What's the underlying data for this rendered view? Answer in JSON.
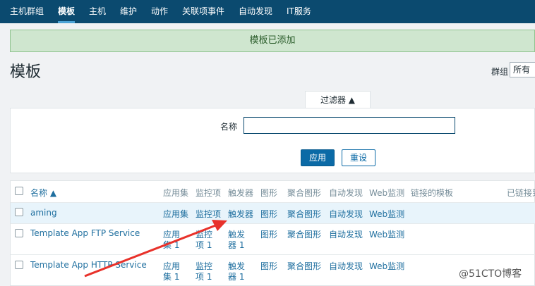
{
  "nav": {
    "items": [
      {
        "label": "主机群组",
        "active": false
      },
      {
        "label": "模板",
        "active": true
      },
      {
        "label": "主机",
        "active": false
      },
      {
        "label": "维护",
        "active": false
      },
      {
        "label": "动作",
        "active": false
      },
      {
        "label": "关联项事件",
        "active": false
      },
      {
        "label": "自动发现",
        "active": false
      },
      {
        "label": "IT服务",
        "active": false
      }
    ]
  },
  "message": "模板已添加",
  "page": {
    "title": "模板"
  },
  "group_filter": {
    "label": "群组",
    "value": "所有"
  },
  "filter": {
    "tab_label": "过滤器 ▲",
    "name_label": "名称",
    "name_value": "",
    "apply_label": "应用",
    "reset_label": "重设"
  },
  "table": {
    "headers": {
      "name": "名称 ▲",
      "applications": "应用集",
      "items": "监控项",
      "triggers": "触发器",
      "graphs": "图形",
      "screens": "聚合图形",
      "discovery": "自动发现",
      "web": "Web监测",
      "linked_templates": "链接的模板",
      "linked_to": "已链接到"
    },
    "rows": [
      {
        "name": "aming",
        "applications": "应用集",
        "items": "监控项",
        "triggers": "触发器",
        "graphs": "图形",
        "screens": "聚合图形",
        "discovery": "自动发现",
        "web": "Web监测"
      },
      {
        "name": "Template App FTP Service",
        "applications_a": "应用",
        "applications_b": "集 1",
        "items_a": "监控",
        "items_b": "项 1",
        "triggers_a": "触发",
        "triggers_b": "器 1",
        "graphs": "图形",
        "screens": "聚合图形",
        "discovery": "自动发现",
        "web": "Web监测"
      },
      {
        "name": "Template App HTTP Service",
        "applications_a": "应用",
        "applications_b": "集 1",
        "items_a": "监控",
        "items_b": "项 1",
        "triggers_a": "触发",
        "triggers_b": "器 1",
        "graphs": "图形",
        "screens": "聚合图形",
        "discovery": "自动发现",
        "web": "Web监测"
      }
    ]
  },
  "watermark": "@51CTO博客",
  "colors": {
    "nav_bg": "#0b4a6f",
    "success_bg": "#cfe6cf",
    "link": "#1f6f9f",
    "arrow": "#e8312a"
  }
}
